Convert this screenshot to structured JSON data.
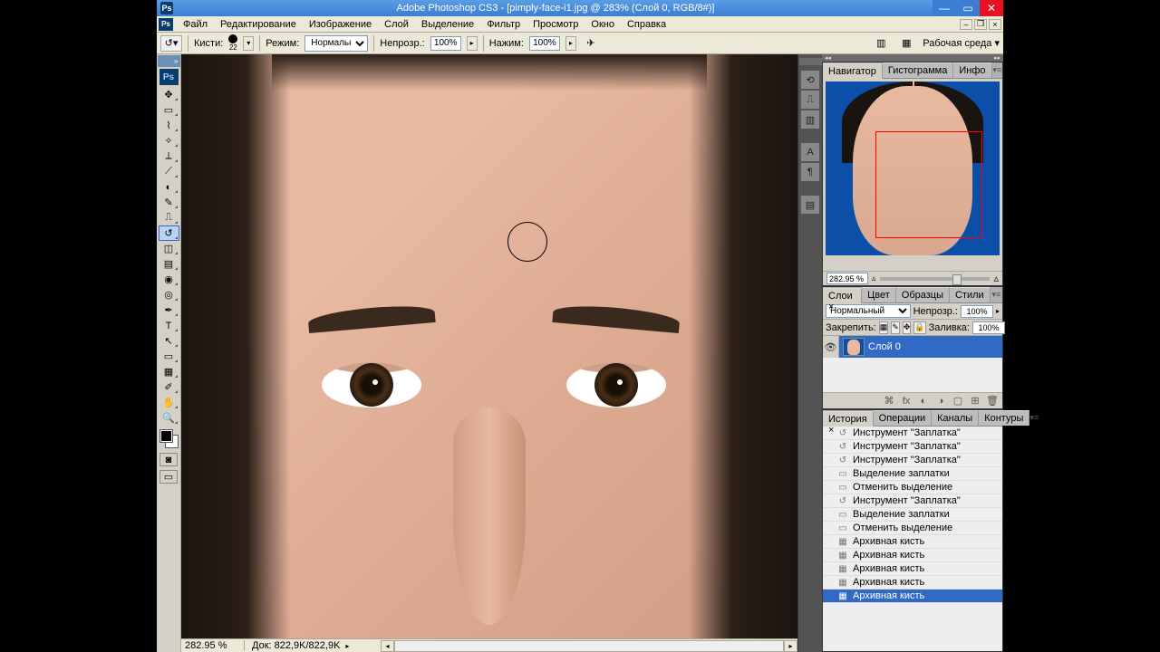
{
  "title": "Adobe Photoshop CS3 - [pimply-face-i1.jpg @ 283% (Слой 0, RGB/8#)]",
  "menu": [
    "Файл",
    "Редактирование",
    "Изображение",
    "Слой",
    "Выделение",
    "Фильтр",
    "Просмотр",
    "Окно",
    "Справка"
  ],
  "opt": {
    "brush_label": "Кисти:",
    "brush_size": "22",
    "mode_label": "Режим:",
    "mode_value": "Нормальный",
    "opacity_label": "Непрозр.:",
    "opacity_value": "100%",
    "flow_label": "Нажим:",
    "flow_value": "100%",
    "workspace_label": "Рабочая среда ▾"
  },
  "tools": [
    {
      "name": "move-tool",
      "g": "✥"
    },
    {
      "name": "marquee-tool",
      "g": "▭"
    },
    {
      "name": "lasso-tool",
      "g": "⌇"
    },
    {
      "name": "wand-tool",
      "g": "✧"
    },
    {
      "name": "crop-tool",
      "g": "⟂"
    },
    {
      "name": "slice-tool",
      "g": "⟋"
    },
    {
      "name": "spot-heal-tool",
      "g": "◐"
    },
    {
      "name": "brush-tool",
      "g": "✎"
    },
    {
      "name": "stamp-tool",
      "g": "⎍"
    },
    {
      "name": "history-brush-tool",
      "g": "↺",
      "active": true
    },
    {
      "name": "eraser-tool",
      "g": "◫"
    },
    {
      "name": "gradient-tool",
      "g": "▤"
    },
    {
      "name": "blur-tool",
      "g": "◉"
    },
    {
      "name": "dodge-tool",
      "g": "◎"
    },
    {
      "name": "pen-tool",
      "g": "✒"
    },
    {
      "name": "type-tool",
      "g": "T"
    },
    {
      "name": "path-tool",
      "g": "↖"
    },
    {
      "name": "shape-tool",
      "g": "▭"
    },
    {
      "name": "notes-tool",
      "g": "▦"
    },
    {
      "name": "eyedrop-tool",
      "g": "✐"
    },
    {
      "name": "hand-tool",
      "g": "✋"
    },
    {
      "name": "zoom-tool",
      "g": "🔍"
    }
  ],
  "status": {
    "zoom": "282.95 %",
    "doc": "Док: 822,9K/822,9K"
  },
  "nav": {
    "tabs": [
      "Навигатор ×",
      "Гистограмма",
      "Инфо"
    ],
    "zoom": "282.95 %"
  },
  "layers": {
    "tabs": [
      "Слои ×",
      "Цвет",
      "Образцы",
      "Стили"
    ],
    "mode": "Нормальный",
    "opacity_label": "Непрозр.:",
    "opacity": "100%",
    "lock_label": "Закрепить:",
    "fill_label": "Заливка:",
    "fill": "100%",
    "layer_name": "Слой 0"
  },
  "history": {
    "tabs": [
      "История ×",
      "Операции",
      "Каналы",
      "Контуры"
    ],
    "items": [
      {
        "icon": "↺",
        "label": "Инструмент \"Заплатка\""
      },
      {
        "icon": "↺",
        "label": "Инструмент \"Заплатка\""
      },
      {
        "icon": "↺",
        "label": "Инструмент \"Заплатка\""
      },
      {
        "icon": "▭",
        "label": "Выделение заплатки"
      },
      {
        "icon": "▭",
        "label": "Отменить выделение"
      },
      {
        "icon": "↺",
        "label": "Инструмент \"Заплатка\""
      },
      {
        "icon": "▭",
        "label": "Выделение заплатки"
      },
      {
        "icon": "▭",
        "label": "Отменить выделение"
      },
      {
        "icon": "▦",
        "label": "Архивная кисть"
      },
      {
        "icon": "▦",
        "label": "Архивная кисть"
      },
      {
        "icon": "▦",
        "label": "Архивная кисть"
      },
      {
        "icon": "▦",
        "label": "Архивная кисть"
      },
      {
        "icon": "▦",
        "label": "Архивная кисть",
        "active": true
      }
    ]
  },
  "dock": [
    {
      "name": "dock-brushes-icon",
      "g": "⟲"
    },
    {
      "name": "dock-clone-icon",
      "g": "⎍"
    },
    {
      "name": "dock-tool-presets-icon",
      "g": "▥"
    },
    {
      "gap": true
    },
    {
      "name": "dock-char-icon",
      "g": "A"
    },
    {
      "name": "dock-para-icon",
      "g": "¶"
    },
    {
      "gap": true
    },
    {
      "name": "dock-layercomp-icon",
      "g": "▤"
    }
  ]
}
